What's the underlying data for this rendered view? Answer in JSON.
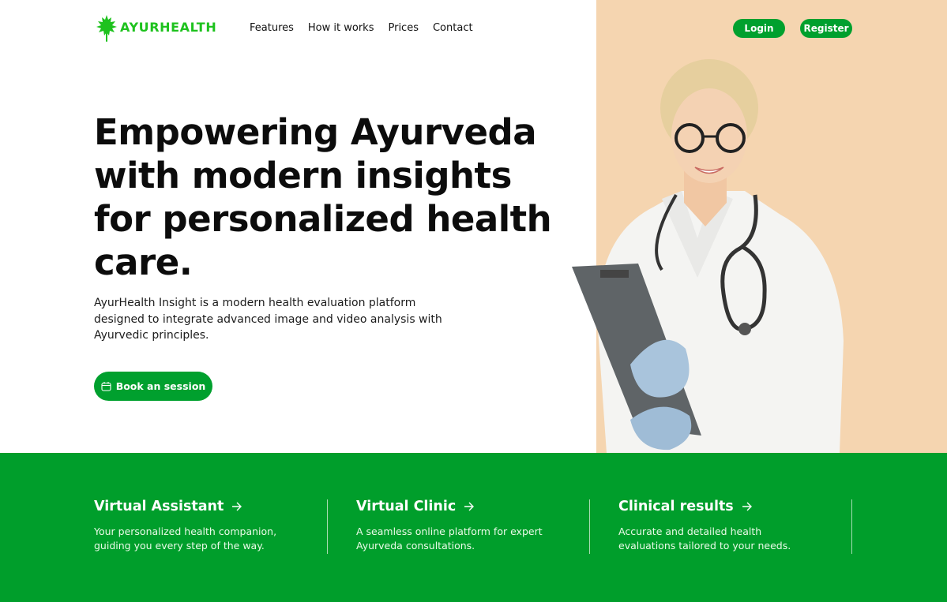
{
  "brand": {
    "name": "AYURHEALTH",
    "accent": "#1ec21e",
    "primary_green": "#00a02e",
    "peach": "#f5d5b0"
  },
  "nav": {
    "items": [
      "Features",
      "How it works",
      "Prices",
      "Contact"
    ]
  },
  "auth": {
    "login_label": "Login",
    "register_label": "Register"
  },
  "hero": {
    "title": "Empowering Ayurveda with modern insights for personalized health care.",
    "description": "AyurHealth Insight is a modern health evaluation platform designed to integrate advanced image and video analysis with Ayurvedic principles.",
    "cta_label": "Book an session",
    "cta_icon": "calendar-icon"
  },
  "features": [
    {
      "title": "Virtual Assistant",
      "description": "Your personalized health companion, guiding you every step of the way.",
      "icon": "arrow-right-icon"
    },
    {
      "title": "Virtual Clinic",
      "description": "A seamless online platform for expert Ayurveda consultations.",
      "icon": "arrow-right-icon"
    },
    {
      "title": "Clinical results",
      "description": "Accurate and detailed health evaluations tailored to your needs.",
      "icon": "arrow-right-icon"
    }
  ]
}
